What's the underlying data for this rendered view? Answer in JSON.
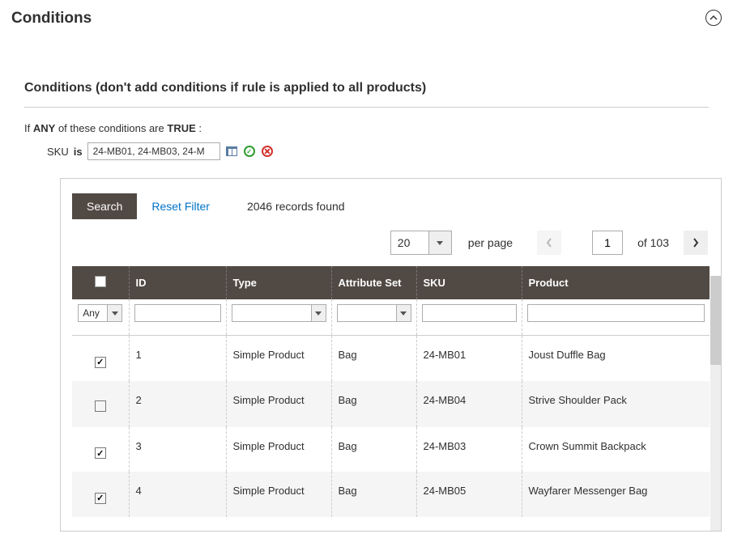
{
  "section_title": "Conditions",
  "sub_title": "Conditions (don't add conditions if rule is applied to all products)",
  "condition_line": {
    "if": "If",
    "any": "ANY",
    "rest": "of these conditions are",
    "true": "TRUE",
    "colon": ":"
  },
  "rule": {
    "attr": "SKU",
    "op": "is",
    "value": "24-MB01, 24-MB03, 24-M"
  },
  "search_btn": "Search",
  "reset_filter": "Reset Filter",
  "records_found": "2046 records found",
  "per_page_value": "20",
  "per_page_label": "per page",
  "page_current": "1",
  "page_of": "of 103",
  "columns": {
    "id": "ID",
    "type": "Type",
    "attr_set": "Attribute Set",
    "sku": "SKU",
    "product": "Product"
  },
  "filter_any": "Any",
  "rows": [
    {
      "checked": true,
      "id": "1",
      "type": "Simple Product",
      "attr_set": "Bag",
      "sku": "24-MB01",
      "product": "Joust Duffle Bag"
    },
    {
      "checked": false,
      "id": "2",
      "type": "Simple Product",
      "attr_set": "Bag",
      "sku": "24-MB04",
      "product": "Strive Shoulder Pack"
    },
    {
      "checked": true,
      "id": "3",
      "type": "Simple Product",
      "attr_set": "Bag",
      "sku": "24-MB03",
      "product": "Crown Summit Backpack"
    },
    {
      "checked": true,
      "id": "4",
      "type": "Simple Product",
      "attr_set": "Bag",
      "sku": "24-MB05",
      "product": "Wayfarer Messenger Bag"
    }
  ]
}
